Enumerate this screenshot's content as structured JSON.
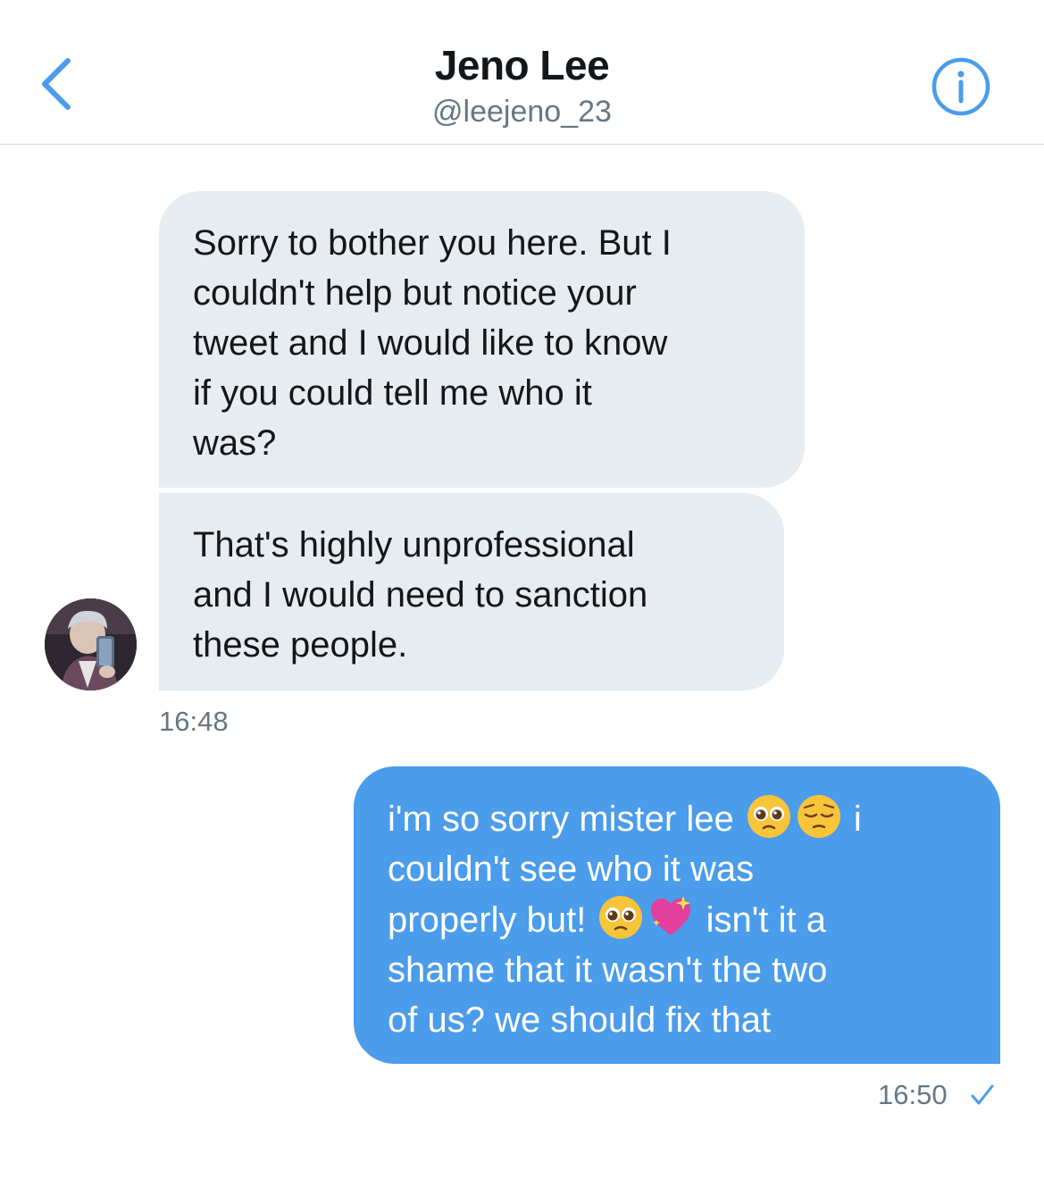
{
  "header": {
    "name": "Jeno Lee",
    "handle": "@leejeno_23",
    "back_icon": "chevron-left-icon",
    "info_icon": "info-circle-icon",
    "accent_color": "#4b9cea"
  },
  "messages": {
    "received": [
      {
        "text": "Sorry to bother you here. But I\ncouldn't help but notice your\ntweet and I would like to know\nif you could tell me who it\nwas?"
      },
      {
        "text": "That's highly unprofessional\nand I would need to sanction\nthese people."
      }
    ],
    "received_time": "16:48",
    "sent": {
      "seg1": "i'm so sorry mister lee ",
      "seg2": " i\ncouldn't see who it was\nproperly but! ",
      "seg3": " isn't it a\nshame that it wasn't the two\nof us? we should fix that",
      "emojis": [
        "pleading-face-emoji",
        "pensive-face-emoji",
        "pleading-face-emoji",
        "sparkling-heart-emoji"
      ]
    },
    "sent_time": "16:50",
    "sent_status_icon": "checkmark-icon"
  },
  "colors": {
    "received_bubble": "#e6ecf0",
    "sent_bubble": "#4b9cea",
    "secondary_text": "#657786"
  }
}
